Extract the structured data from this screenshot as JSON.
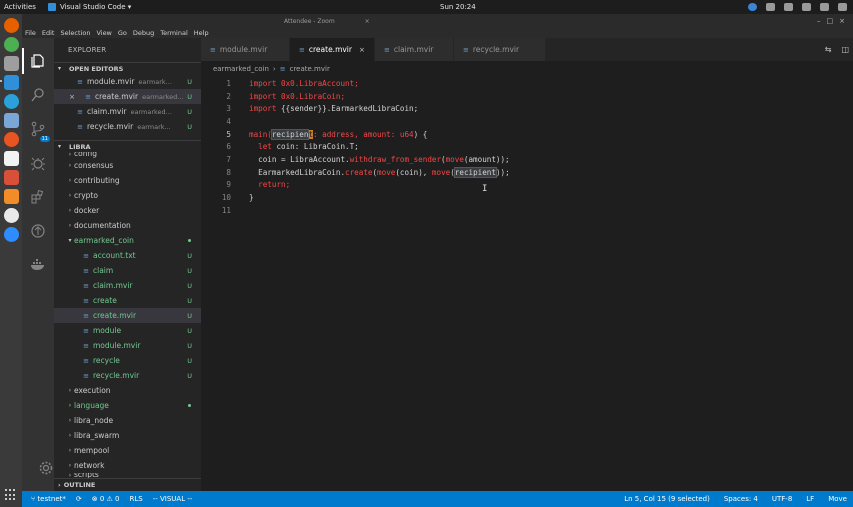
{
  "system_bar": {
    "activities": "Activities",
    "app": "Visual Studio Code ▾",
    "clock": "Sun 20:24",
    "window_title": "Attendee - Zoom"
  },
  "menu": [
    "File",
    "Edit",
    "Selection",
    "View",
    "Go",
    "Debug",
    "Terminal",
    "Help"
  ],
  "explorer": {
    "title": "EXPLORER",
    "open_editors_label": "OPEN EDITORS",
    "open_editors": [
      {
        "name": "module.mvir",
        "desc": "earmark...",
        "status": "U"
      },
      {
        "name": "create.mvir",
        "desc": "earmarked...",
        "status": "U"
      },
      {
        "name": "claim.mvir",
        "desc": "earmarked...",
        "status": "U"
      },
      {
        "name": "recycle.mvir",
        "desc": "earmark...",
        "status": "U"
      }
    ],
    "project_label": "LIBRA",
    "tree_cut_top": "config",
    "tree_top": [
      "consensus",
      "contributing",
      "crypto",
      "docker",
      "documentation"
    ],
    "folder_open": "earmarked_coin",
    "folder_children": [
      {
        "name": "account.txt",
        "status": "U"
      },
      {
        "name": "claim",
        "status": "U"
      },
      {
        "name": "claim.mvir",
        "status": "U"
      },
      {
        "name": "create",
        "status": "U"
      },
      {
        "name": "create.mvir",
        "status": "U"
      },
      {
        "name": "module",
        "status": "U"
      },
      {
        "name": "module.mvir",
        "status": "U"
      },
      {
        "name": "recycle",
        "status": "U"
      },
      {
        "name": "recycle.mvir",
        "status": "U"
      }
    ],
    "tree_bottom": [
      "execution",
      "language",
      "libra_node",
      "libra_swarm",
      "mempool",
      "network"
    ],
    "tree_cut_bottom": "scripts",
    "outline_label": "OUTLINE"
  },
  "activity_badge": "11",
  "tabs": [
    {
      "name": "module.mvir"
    },
    {
      "name": "create.mvir",
      "close": "×"
    },
    {
      "name": "claim.mvir"
    },
    {
      "name": "recycle.mvir"
    }
  ],
  "breadcrumb": {
    "folder": "earmarked_coin",
    "sep": "›",
    "file": "create.mvir"
  },
  "code": {
    "l1": {
      "a": "import",
      "b": " 0x0.LibraAccount;"
    },
    "l2": {
      "a": "import",
      "b": " 0x0.LibraCoin;"
    },
    "l3": {
      "a": "import",
      "b": " {{sender}}.EarmarkedLibraCoin;"
    },
    "l5": {
      "a": "main(",
      "b": "recipien",
      "c": "t",
      "d": ": address, amount: ",
      "e": "u64",
      "f": ") {"
    },
    "l6": {
      "a": "let",
      "b": " coin: LibraCoin.T;"
    },
    "l7": {
      "a": "coin = LibraAccount.",
      "b": "withdraw_from_sender",
      "c": "(",
      "d": "move",
      "e": "(amount));"
    },
    "l8": {
      "a": "EarmarkedLibraCoin.",
      "b": "create",
      "c": "(",
      "d": "move",
      "e": "(coin), ",
      "f": "move",
      "g": "(",
      "h": "recipient",
      "i": "));"
    },
    "l9": {
      "a": "return;"
    },
    "l10": {
      "a": "}"
    },
    "line_numbers": [
      "1",
      "2",
      "3",
      "4",
      "5",
      "6",
      "7",
      "8",
      "9",
      "10",
      "11"
    ]
  },
  "status": {
    "branch": "testnet*",
    "sync": "⟳",
    "errors": "0",
    "warnings": "0",
    "rls": "RLS",
    "mode": "-- VISUAL --",
    "position": "Ln 5, Col 15 (9 selected)",
    "spaces": "Spaces: 4",
    "encoding": "UTF-8",
    "eol": "LF",
    "language": "Move"
  },
  "colors": {
    "accent": "#007acc",
    "keyword_red": "#f44747",
    "untracked_green": "#73c991"
  }
}
